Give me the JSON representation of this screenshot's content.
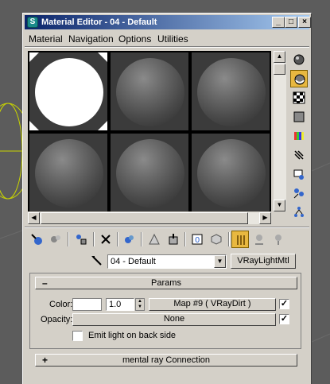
{
  "window": {
    "title": "Material Editor - 04 - Default",
    "app_icon": "3ds-max-logo-icon",
    "minimize_glyph": "_",
    "maximize_glyph": "□",
    "close_glyph": "×"
  },
  "menu": {
    "items": [
      "Material",
      "Navigation",
      "Options",
      "Utilities"
    ]
  },
  "material": {
    "name": "04 - Default",
    "type_button": "VRayLightMtl"
  },
  "params": {
    "header": "Params",
    "toggle": "–",
    "color_label": "Color:",
    "color_value": "#ffffff",
    "multiplier": "1.0",
    "color_map": "Map #9  ( VRayDirt )",
    "color_map_enabled": "✓",
    "opacity_label": "Opacity:",
    "opacity_map": "None",
    "opacity_map_enabled": "✓",
    "emit_back_label": "Emit light on back side",
    "emit_back_checked": ""
  },
  "mental_ray": {
    "header": "mental ray Connection",
    "toggle": "+"
  },
  "icons": {
    "right_toolbar": [
      "sample-type-sphere-icon",
      "backlight-icon",
      "background-checker-icon",
      "sample-uv-tiling-icon",
      "video-color-check-icon",
      "make-preview-icon",
      "options-icon",
      "select-by-material-icon",
      "material-map-navigator-icon"
    ],
    "bottom_toolbar": [
      "get-material-icon",
      "put-material-to-scene-icon",
      "assign-material-to-selection-icon",
      "reset-map-icon",
      "make-material-copy-icon",
      "make-unique-icon",
      "put-to-library-icon",
      "material-effects-channel-icon",
      "show-map-in-viewport-icon",
      "show-end-result-icon",
      "go-to-parent-icon",
      "go-forward-to-sibling-icon"
    ]
  },
  "colors": {
    "title_start": "#0a246a",
    "title_end": "#a6caf0",
    "selected_tool": "#e8b840",
    "panel": "#d4d0c8"
  }
}
